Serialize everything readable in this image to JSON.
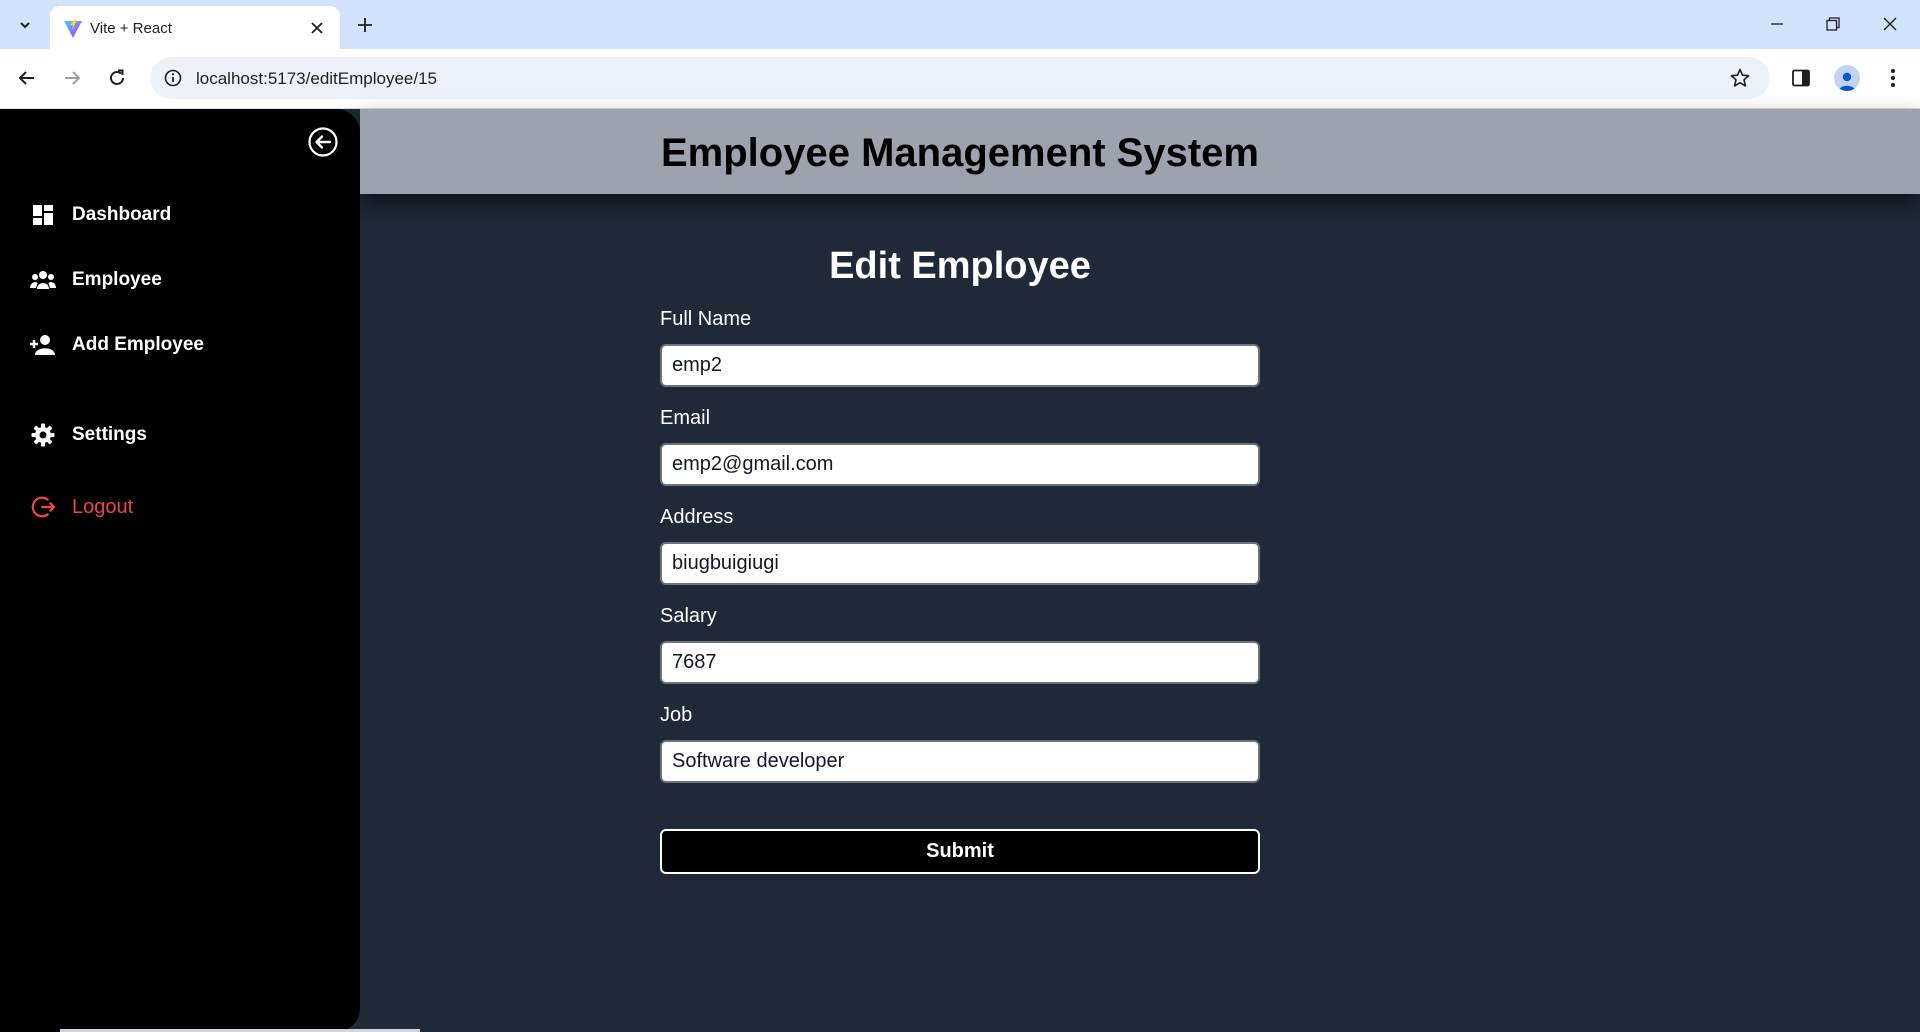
{
  "browser": {
    "tab_title": "Vite + React",
    "url": "localhost:5173/editEmployee/15"
  },
  "header": {
    "title": "Employee Management System"
  },
  "sidebar": {
    "items": [
      {
        "label": "Dashboard",
        "icon": "dashboard-icon"
      },
      {
        "label": "Employee",
        "icon": "people-icon"
      },
      {
        "label": "Add Employee",
        "icon": "add-person-icon"
      },
      {
        "label": "Settings",
        "icon": "gear-icon"
      },
      {
        "label": "Logout",
        "icon": "logout-icon"
      }
    ]
  },
  "form": {
    "title": "Edit Employee",
    "fields": [
      {
        "label": "Full Name",
        "value": "emp2"
      },
      {
        "label": "Email",
        "value": "emp2@gmail.com"
      },
      {
        "label": "Address",
        "value": "biugbuigiugi"
      },
      {
        "label": "Salary",
        "value": "7687"
      },
      {
        "label": "Job",
        "value": "Software developer"
      }
    ],
    "submit_label": "Submit"
  },
  "colors": {
    "sidebar_bg": "#000000",
    "header_bg": "#9ca3af",
    "main_bg": "#1f2937",
    "logout": "#ef4444"
  }
}
